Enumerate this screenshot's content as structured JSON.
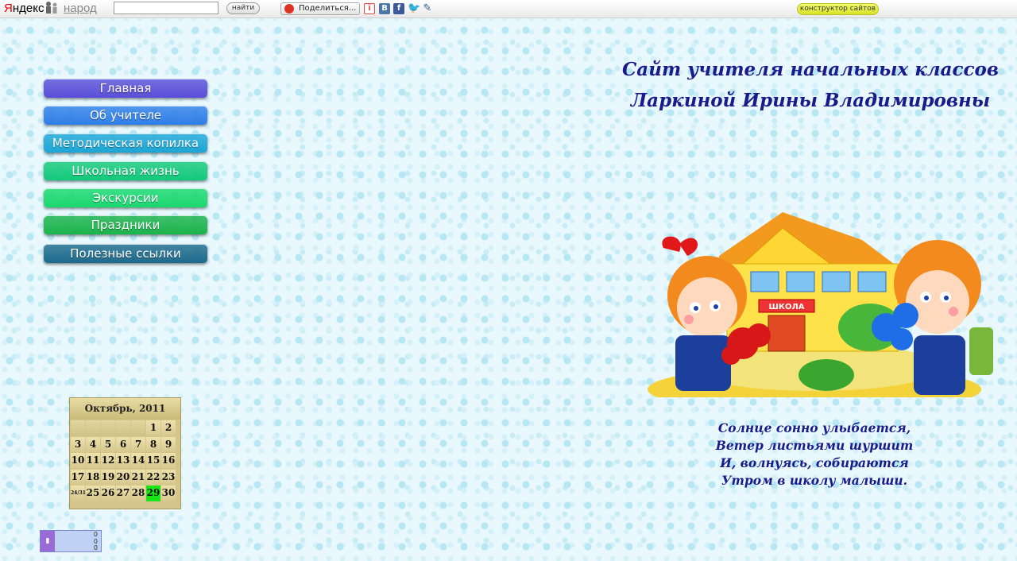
{
  "topbar": {
    "logo_ya_first": "Я",
    "logo_ya_rest": "ндекс",
    "logo_narod": "народ",
    "search_value": "",
    "search_button": "найти",
    "share_button": "Поделиться...",
    "social": {
      "vk": "B",
      "fb": "f",
      "tw": "🐦",
      "lj": "✎"
    },
    "builder_button": "конструктор сайтов"
  },
  "nav": {
    "items": [
      {
        "label": "Главная",
        "color": "#5a4ed8"
      },
      {
        "label": "Об учителе",
        "color": "#2f7ee8"
      },
      {
        "label": "Методическая копилка",
        "color": "#1ba6d6"
      },
      {
        "label": "Школьная жизнь",
        "color": "#12c97a"
      },
      {
        "label": "Экскурсии",
        "color": "#19d86e"
      },
      {
        "label": "Праздники",
        "color": "#1ab34a"
      },
      {
        "label": "Полезные ссылки",
        "color": "#1d6a8c"
      }
    ]
  },
  "header": {
    "title_line1": "Сайт учителя начальных классов",
    "title_line2": "Ларкиной Ирины Владимировны"
  },
  "illustration": {
    "school_sign": "ШКОЛА"
  },
  "poem": {
    "lines": [
      "Солнце сонно улыбается,",
      "Ветер листьями шуршит",
      "И, волнуясь, собираются",
      "Утром в школу малыши."
    ]
  },
  "calendar": {
    "title": "Октябрь, 2011",
    "today": "29",
    "cells": [
      "",
      "",
      "",
      "",
      "",
      "1",
      "2",
      "3",
      "4",
      "5",
      "6",
      "7",
      "8",
      "9",
      "10",
      "11",
      "12",
      "13",
      "14",
      "15",
      "16",
      "17",
      "18",
      "19",
      "20",
      "21",
      "22",
      "23",
      "24/31",
      "25",
      "26",
      "27",
      "28",
      "29",
      "30"
    ]
  },
  "counter": {
    "stats": [
      "0",
      "0",
      "0"
    ]
  },
  "colors": {
    "title": "#1a1a8a",
    "today": "#19e619"
  }
}
